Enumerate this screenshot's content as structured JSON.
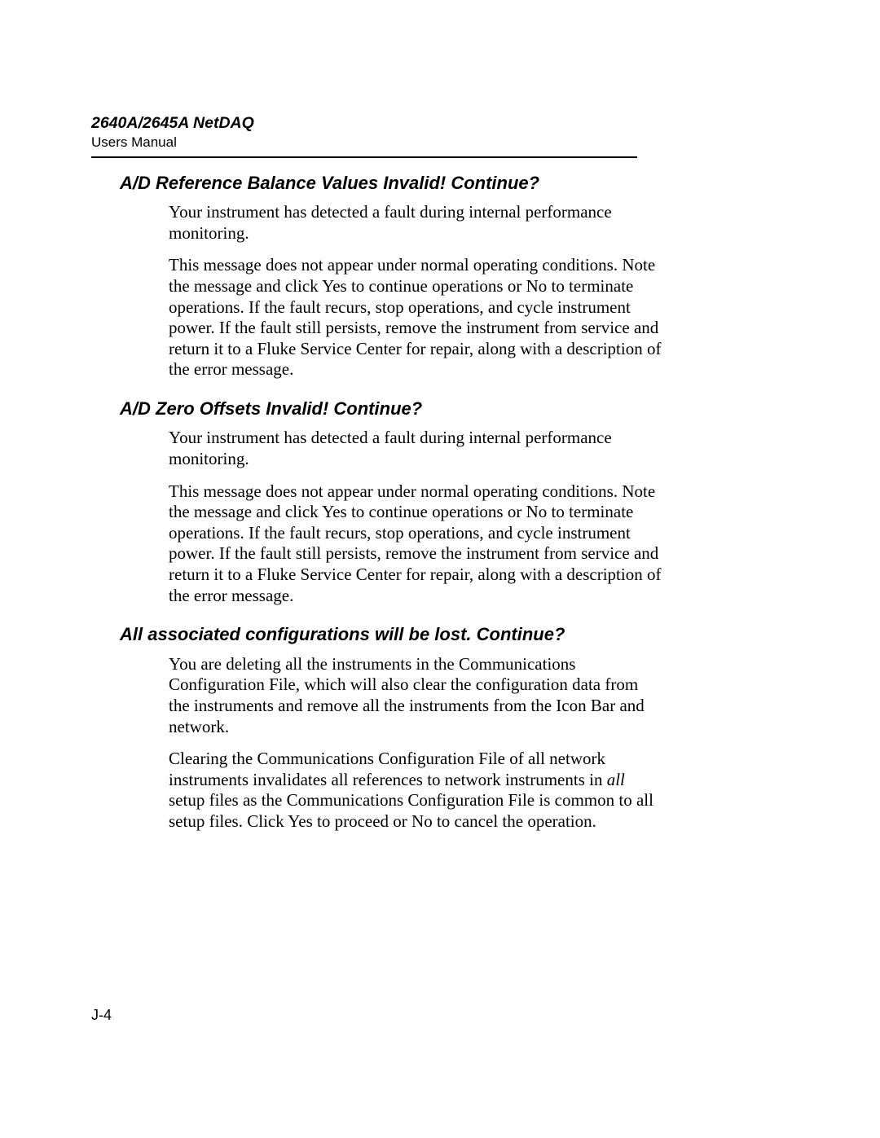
{
  "header": {
    "title": "2640A/2645A NetDAQ",
    "subtitle": "Users Manual"
  },
  "sections": [
    {
      "heading": "A/D Reference Balance Values Invalid!  Continue?",
      "paragraphs": [
        "Your instrument has detected a fault during internal performance monitoring.",
        "This message does not appear under normal operating conditions. Note the message and click Yes to continue operations or No to terminate operations. If the fault recurs, stop operations, and cycle instrument power. If the fault still persists, remove the instrument from service and return it to a Fluke Service Center for repair, along with a description of the error message."
      ]
    },
    {
      "heading": "A/D Zero Offsets Invalid!  Continue?",
      "paragraphs": [
        "Your instrument has detected a fault during internal performance monitoring.",
        "This message does not appear under normal operating conditions. Note the message and click Yes to continue operations or No to terminate operations. If the fault recurs, stop operations, and cycle instrument power. If the fault still persists, remove the instrument from service and return it to a Fluke Service Center for repair, along with a description of the error message."
      ]
    },
    {
      "heading": "All associated configurations will be lost.  Continue?",
      "paragraphs": [
        "You are deleting all the instruments in the Communications Configuration File, which will also clear the configuration data from the instruments and remove all the instruments from the Icon Bar and network."
      ],
      "rich_paragraph": {
        "pre": "Clearing the Communications Configuration File of all network instruments invalidates all references to network instruments in ",
        "ital": "all",
        "post": " setup files as the Communications Configuration File is common to all setup files. Click Yes to proceed or No to cancel the operation."
      }
    }
  ],
  "page_number": "J-4"
}
